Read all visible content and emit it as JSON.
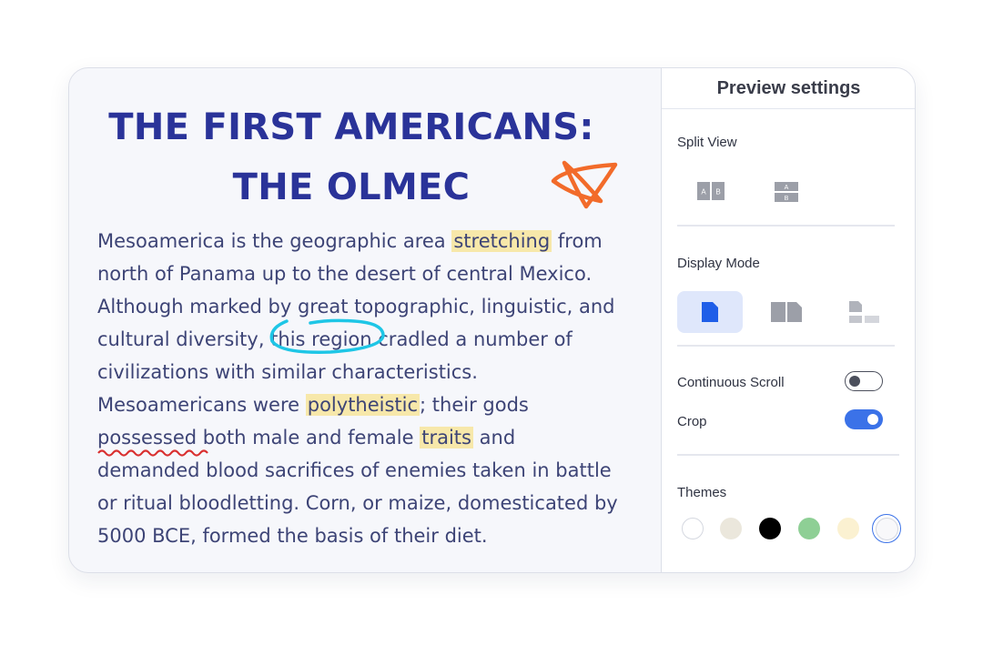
{
  "document": {
    "title_line1": "THE FIRST AMERICANS:",
    "title_line2": "THE OLMEC",
    "lines": [
      [
        "Mesoamerica is the geographic area ",
        "stretching",
        " from"
      ],
      [
        "north of Panama up to the desert of central Mexico."
      ],
      [
        "Although marked by great topographic, linguistic, and"
      ],
      [
        "cultural diversity, this region cradled a number of"
      ],
      [
        "civilizations with similar characteristics."
      ],
      [
        "Mesoamericans were ",
        "polytheistic",
        "; their gods"
      ],
      [
        "possessed",
        " both male and female ",
        "traits",
        " and"
      ],
      [
        "demanded blood sacrifices of enemies taken in battle"
      ],
      [
        "or ritual bloodletting. Corn, or maize, domesticated by"
      ],
      [
        "5000 BCE, formed the basis of their diet."
      ]
    ]
  },
  "panel": {
    "title": "Preview settings",
    "split_view_label": "Split View",
    "split_options": [
      "split-vertical-icon",
      "split-horizontal-icon"
    ],
    "split_icon_text": {
      "a": "A",
      "b": "B"
    },
    "display_mode_label": "Display Mode",
    "display_modes": [
      "single-page-icon",
      "double-page-icon",
      "thumbnail-page-icon"
    ],
    "display_mode_selected": "single-page-icon",
    "continuous_scroll_label": "Continuous Scroll",
    "continuous_scroll_on": false,
    "crop_label": "Crop",
    "crop_on": true,
    "themes_label": "Themes",
    "themes": [
      "#ffffff",
      "#ebe7dc",
      "#000000",
      "#8ecf95",
      "#fbf1d1",
      "#f8f8fa"
    ],
    "theme_selected_index": 5
  },
  "colors": {
    "title": "#2a3399",
    "text": "#3d4476",
    "highlight": "#f7e8aa",
    "accent": "#3b72e8",
    "star": "#f26b2a",
    "circle_annotation": "#1ec6e6",
    "squiggle": "#d93030"
  }
}
